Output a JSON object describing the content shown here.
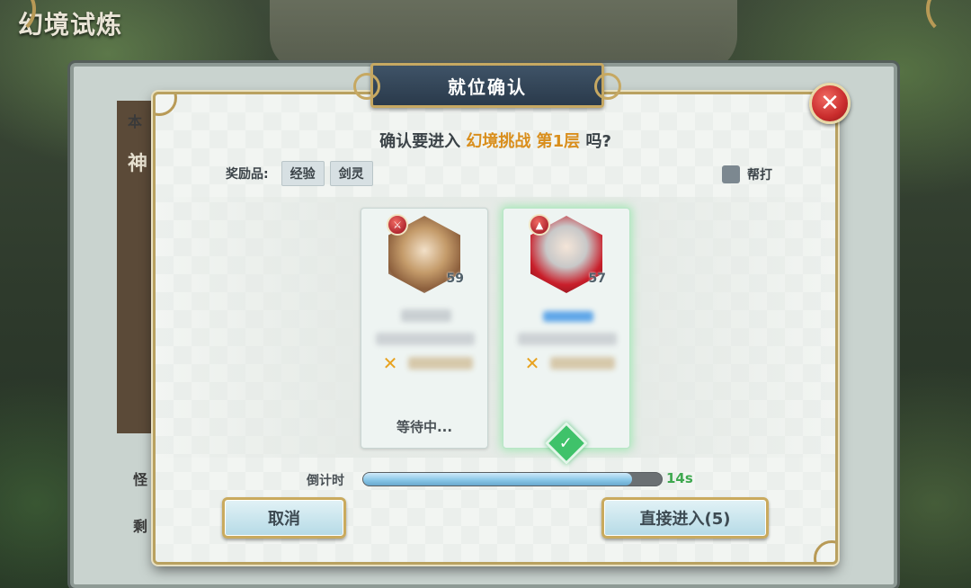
{
  "background": {
    "game_title": "幻境试炼",
    "side_label_1": "怪",
    "side_label_2": "剩",
    "side_label_3": "本",
    "side_label_4": "神"
  },
  "dialog": {
    "title": "就位确认",
    "question_prefix": "确认要进入 ",
    "question_highlight": "幻境挑战 第1层",
    "question_suffix": " 吗?",
    "reward_label": "奖励品:",
    "rewards": [
      "经验",
      "剑灵"
    ],
    "help_label": "帮打",
    "help_checked": false,
    "players": [
      {
        "level": "59",
        "status": "等待中...",
        "ready": false,
        "avatar": "knight-portrait"
      },
      {
        "level": "57",
        "status": "",
        "ready": true,
        "avatar": "ninja-portrait"
      }
    ],
    "countdown_label": "倒计时",
    "countdown_value": "14s",
    "countdown_progress": 0.9,
    "cancel_label": "取消",
    "enter_label": "直接进入(5)",
    "close_icon": "close-icon"
  },
  "colors": {
    "accent_orange": "#d98e1c",
    "timer_green": "#3ea84f",
    "frame_gold": "#b9a160"
  }
}
